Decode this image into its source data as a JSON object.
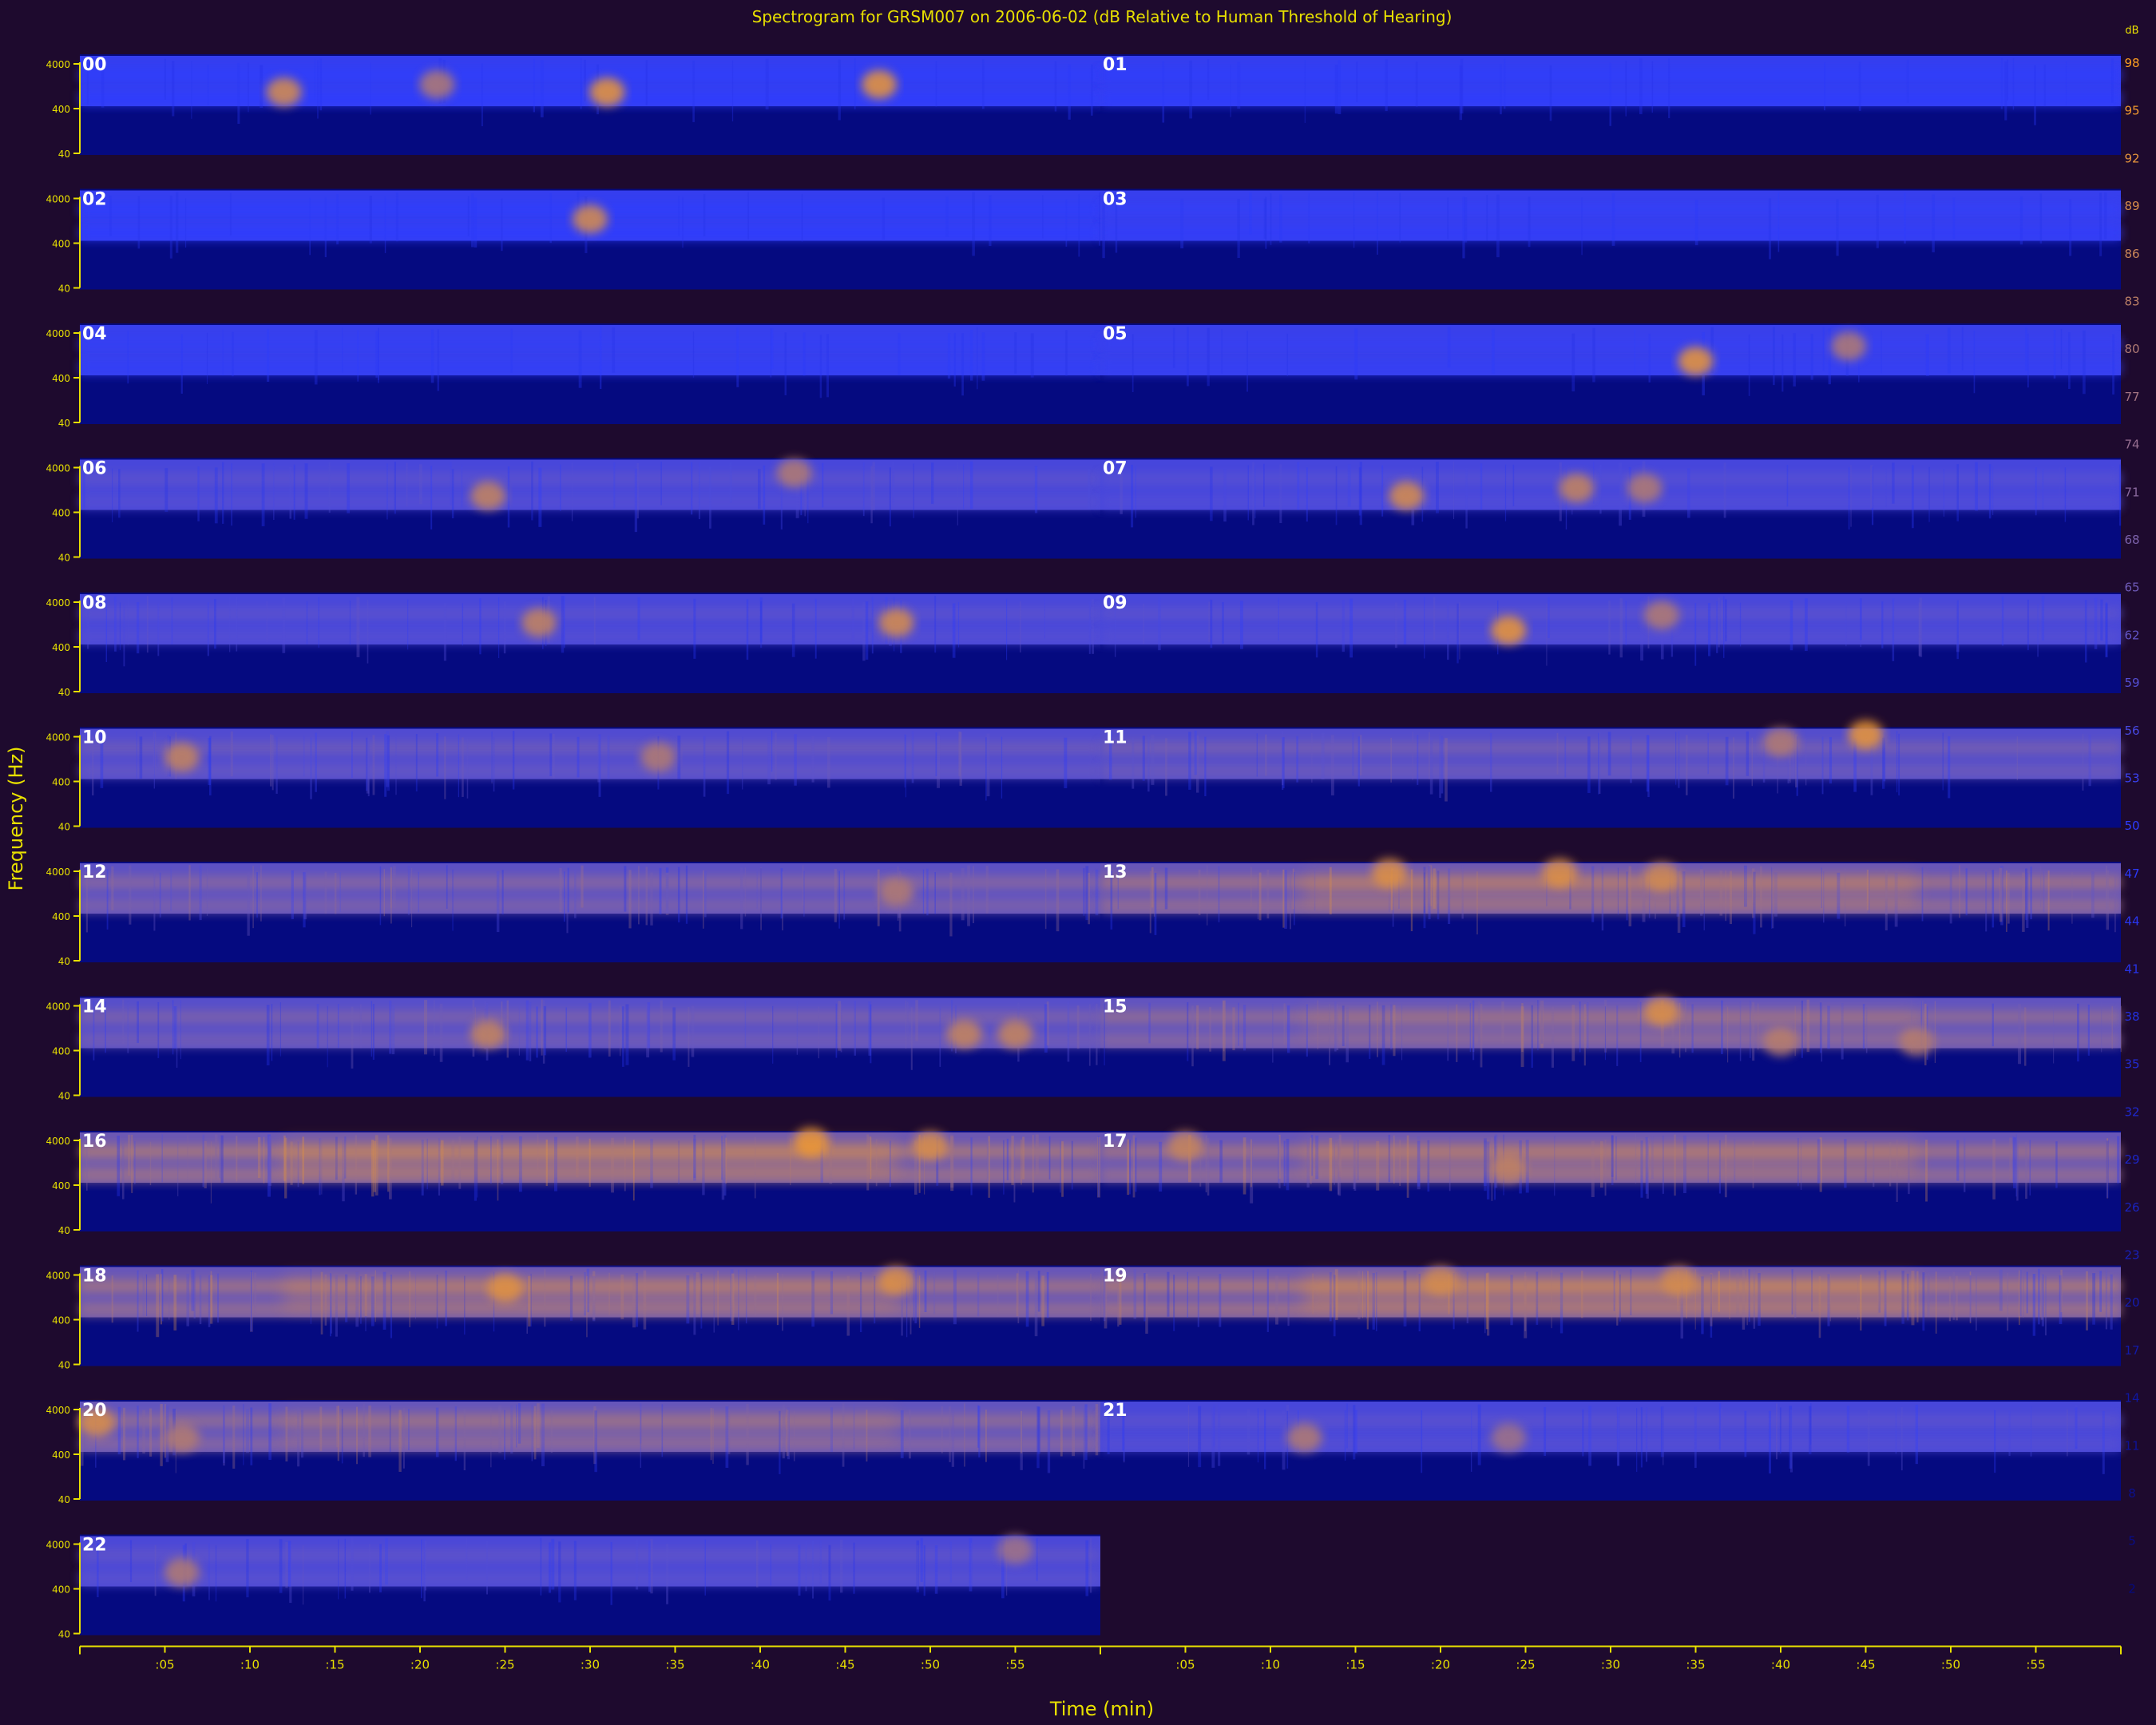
{
  "chart_data": {
    "type": "heatmap",
    "title": "Spectrogram for GRSM007 on 2006-06-02 (dB Relative to Human Threshold of Hearing)",
    "xlabel": "Time (min)",
    "ylabel": "Frequency (Hz)",
    "freq_ticks": [
      "4000",
      "400",
      "40"
    ],
    "time_ticks": [
      ":05",
      ":10",
      ":15",
      ":20",
      ":25",
      ":30",
      ":35",
      ":40",
      ":45",
      ":50",
      ":55"
    ],
    "colorbar": {
      "unit": "dB",
      "ticks": [
        "98",
        "95",
        "92",
        "89",
        "86",
        "83",
        "80",
        "77",
        "74",
        "71",
        "68",
        "65",
        "62",
        "59",
        "56",
        "53",
        "50",
        "47",
        "44",
        "41",
        "38",
        "35",
        "32",
        "29",
        "26",
        "23",
        "20",
        "17",
        "14",
        "11",
        "8",
        "5",
        "2"
      ]
    },
    "colors": {
      "background": "#1e0a2e",
      "axis": "#e8e000",
      "low": "#050a80",
      "mid": "#2d3cff",
      "high": "#ffa020"
    },
    "segments": [
      {
        "hour": "00",
        "level": 0.1,
        "events": [
          [
            12,
            0.5,
            0.8
          ],
          [
            21,
            0.4,
            0.6
          ],
          [
            31,
            0.5,
            0.9
          ],
          [
            47,
            0.4,
            0.9
          ]
        ]
      },
      {
        "hour": "01",
        "level": 0.1,
        "events": []
      },
      {
        "hour": "02",
        "level": 0.1,
        "events": [
          [
            30,
            0.4,
            0.8
          ]
        ]
      },
      {
        "hour": "03",
        "level": 0.12,
        "events": []
      },
      {
        "hour": "04",
        "level": 0.13,
        "events": []
      },
      {
        "hour": "05",
        "level": 0.14,
        "events": [
          [
            35,
            0.5,
            0.9
          ],
          [
            44,
            0.3,
            0.6
          ]
        ]
      },
      {
        "hour": "06",
        "level": 0.3,
        "events": [
          [
            24,
            0.5,
            0.7
          ],
          [
            42,
            0.2,
            0.6
          ]
        ]
      },
      {
        "hour": "07",
        "level": 0.28,
        "events": [
          [
            18,
            0.5,
            0.8
          ],
          [
            28,
            0.4,
            0.7
          ],
          [
            32,
            0.4,
            0.6
          ]
        ]
      },
      {
        "hour": "08",
        "level": 0.3,
        "events": [
          [
            27,
            0.4,
            0.7
          ],
          [
            48,
            0.4,
            0.8
          ]
        ]
      },
      {
        "hour": "09",
        "level": 0.3,
        "events": [
          [
            24,
            0.5,
            0.9
          ],
          [
            33,
            0.3,
            0.6
          ]
        ]
      },
      {
        "hour": "10",
        "level": 0.38,
        "events": [
          [
            6,
            0.4,
            0.7
          ],
          [
            34,
            0.4,
            0.6
          ]
        ]
      },
      {
        "hour": "11",
        "level": 0.42,
        "events": [
          [
            45,
            0.1,
            0.9
          ],
          [
            40,
            0.2,
            0.6
          ]
        ]
      },
      {
        "hour": "12",
        "level": 0.5,
        "events": [
          [
            48,
            0.4,
            0.6
          ]
        ]
      },
      {
        "hour": "13",
        "level": 0.62,
        "events": [
          [
            17,
            0.15,
            0.8
          ],
          [
            27,
            0.15,
            0.8
          ],
          [
            33,
            0.2,
            0.7
          ]
        ]
      },
      {
        "hour": "14",
        "level": 0.45,
        "events": [
          [
            24,
            0.5,
            0.7
          ],
          [
            52,
            0.5,
            0.7
          ],
          [
            55,
            0.5,
            0.7
          ]
        ]
      },
      {
        "hour": "15",
        "level": 0.55,
        "events": [
          [
            33,
            0.2,
            0.8
          ],
          [
            40,
            0.6,
            0.6
          ],
          [
            48,
            0.6,
            0.6
          ]
        ]
      },
      {
        "hour": "16",
        "level": 0.66,
        "events": [
          [
            43,
            0.15,
            0.9
          ],
          [
            50,
            0.2,
            0.8
          ]
        ]
      },
      {
        "hour": "17",
        "level": 0.62,
        "events": [
          [
            5,
            0.2,
            0.7
          ],
          [
            24,
            0.5,
            0.6
          ]
        ]
      },
      {
        "hour": "18",
        "level": 0.62,
        "events": [
          [
            25,
            0.3,
            0.8
          ],
          [
            48,
            0.2,
            0.8
          ]
        ]
      },
      {
        "hour": "19",
        "level": 0.68,
        "events": [
          [
            20,
            0.2,
            0.7
          ],
          [
            34,
            0.2,
            0.7
          ]
        ]
      },
      {
        "hour": "20",
        "level": 0.55,
        "events": [
          [
            1,
            0.3,
            0.8
          ],
          [
            6,
            0.5,
            0.6
          ]
        ]
      },
      {
        "hour": "21",
        "level": 0.3,
        "events": [
          [
            12,
            0.5,
            0.6
          ],
          [
            24,
            0.5,
            0.5
          ]
        ]
      },
      {
        "hour": "22",
        "level": 0.32,
        "events": [
          [
            6,
            0.5,
            0.6
          ],
          [
            55,
            0.2,
            0.5
          ]
        ]
      }
    ]
  }
}
